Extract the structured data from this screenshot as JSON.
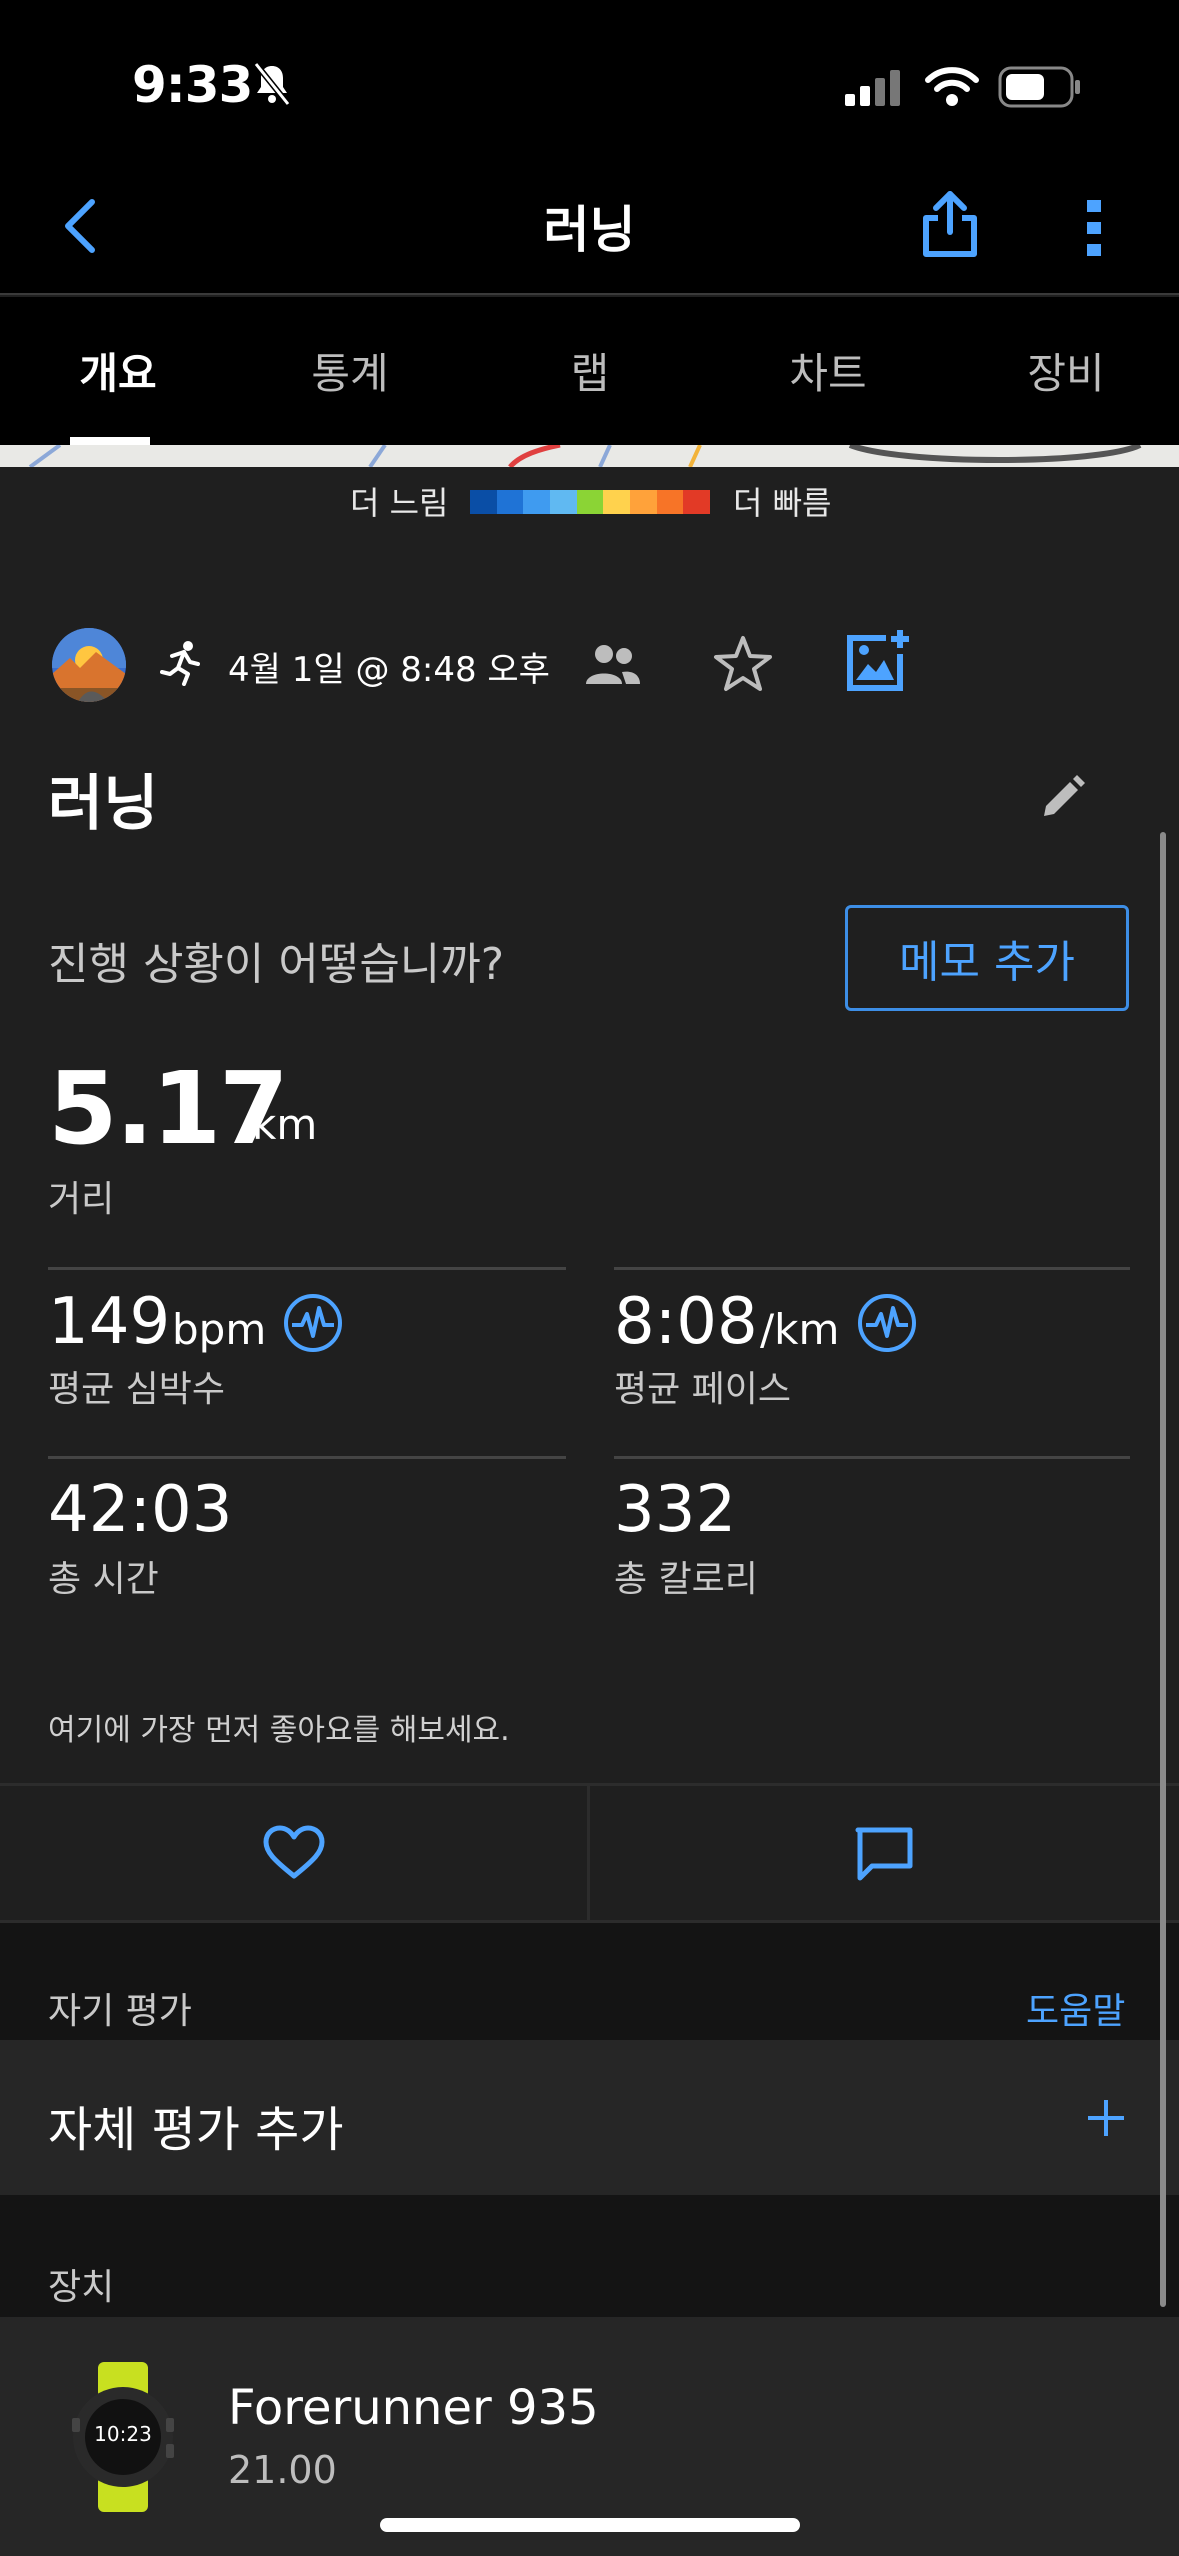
{
  "status_bar": {
    "time": "9:33"
  },
  "header": {
    "title": "러닝"
  },
  "tabs": [
    {
      "label": "개요",
      "active": true
    },
    {
      "label": "통계",
      "active": false
    },
    {
      "label": "랩",
      "active": false
    },
    {
      "label": "차트",
      "active": false
    },
    {
      "label": "장비",
      "active": false
    }
  ],
  "pace_legend": {
    "slow_label": "더 느림",
    "fast_label": "더 빠름",
    "colors": [
      "#0a4ea6",
      "#1f73d6",
      "#3f9bf0",
      "#60b9f2",
      "#8bd435",
      "#ffd24d",
      "#ffa23a",
      "#f77427",
      "#e23a26"
    ]
  },
  "activity": {
    "type_icon": "running-icon",
    "datetime": "4월 1일 @ 8:48 오후",
    "title": "러닝",
    "prompt": "진행 상황이 어떻습니까?",
    "memo_button": "메모 추가"
  },
  "distance": {
    "value": "5.17",
    "unit": "km",
    "label": "거리"
  },
  "stats": {
    "heart_rate": {
      "value": "149",
      "unit": "bpm",
      "label": "평균 심박수"
    },
    "pace": {
      "value": "8:08",
      "unit": "/km",
      "label": "평균 페이스"
    },
    "time": {
      "value": "42:03",
      "label": "총 시간"
    },
    "calories": {
      "value": "332",
      "label": "총 칼로리"
    }
  },
  "social": {
    "likes_text": "여기에 가장 먼저 좋아요를 해보세요."
  },
  "self_eval": {
    "section_title": "자기 평가",
    "help_link": "도움말",
    "add_label": "자체 평가 추가"
  },
  "device": {
    "section_title": "장치",
    "name": "Forerunner 935",
    "version": "21.00",
    "watch_time": "10:23"
  },
  "colors": {
    "accent": "#4da3ff",
    "background": "#1f1f1f"
  }
}
